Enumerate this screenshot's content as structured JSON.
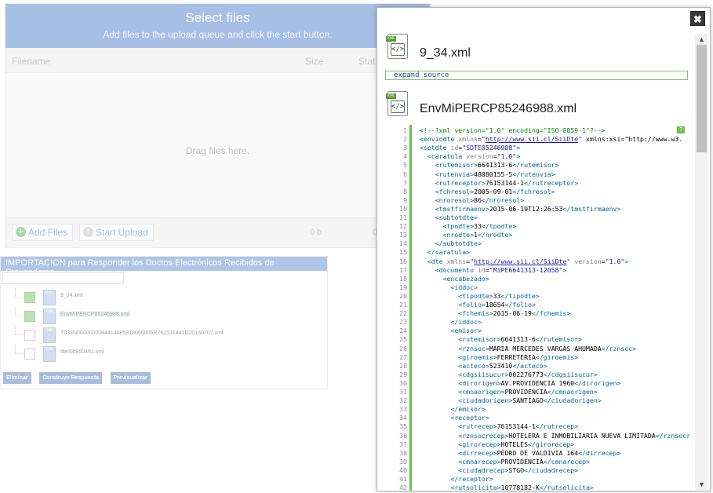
{
  "uploader": {
    "title": "Select files",
    "subtitle": "Add files to the upload queue and click the start button.",
    "col_filename": "Filename",
    "col_size": "Size",
    "col_status": "Stat",
    "drop_text": "Drag files here.",
    "add_files": "Add Files",
    "start_upload": "Start Upload",
    "total_size": "0 b",
    "total_status": "0"
  },
  "import_panel": {
    "title": "IMPORTACION para Responder los Doctos Electrónicos Recibidos de Proveedores",
    "files": [
      {
        "name": "9_34.xml",
        "checked": true
      },
      {
        "name": "EnvMiPERCP85246988.xml",
        "checked": true
      },
      {
        "name": "T033N0000000084414485918060006R761531441D20150707.xml",
        "checked": false
      },
      {
        "name": "dte33f800461.xml",
        "checked": false
      }
    ],
    "buttons": [
      "Eliminar",
      "Construye Respuesta",
      "Previsualizar"
    ]
  },
  "modal": {
    "close_label": "✖",
    "file1": "9_34.xml",
    "expand": "expand source",
    "file2": "EnvMiPERCP85246988.xml",
    "xml_badge": "XML",
    "help_badge": "?",
    "code_lines": [
      "<!--?xml version=\"1.0\" encoding=\"ISO-8859-1\"?-->",
      "<enviodte xmlns=\"http://www.sii.cl/SiiDte\" xmlns:xsi=\"http://www.w3.",
      "<setdte id=\"SDTE85246988\">",
      "  <caratula version=\"1.0\">",
      "    <rutemisor>6641313-6</rutemisor>",
      "    <rutenvia>48080155-5</rutenvia>",
      "    <rutreceptor>76153144-1</rutreceptor>",
      "    <fchresol>2005-09-01</fchresol>",
      "    <nroresol>86</nroresol>",
      "    <tmstfirmaenv>2015-06-19T12:26:53</tmstfirmaenv>",
      "    <subtotdte>",
      "      <tpodte>33</tpodte>",
      "      <nrodte>1</nrodte>",
      "    </subtotdte>",
      "  </caratula>",
      "  <dte xmlns=\"http://www.sii.cl/SiiDte\" version=\"1.0\">",
      "    <documento id=\"MiPE6641313-12058\">",
      "      <encabezado>",
      "        <iddoc>",
      "          <tipodte>33</tipodte>",
      "          <folio>18654</folio>",
      "          <fchemis>2015-06-19</fchemis>",
      "        </iddoc>",
      "        <emisor>",
      "          <rutemisor>6641313-6</rutemisor>",
      "          <rznsoc>MARIA MERCEDES VARGAS AHUMADA</rznsoc>",
      "          <giroemis>FERRETERIA</giroemis>",
      "          <acteco>523410</acteco>",
      "          <cdgsiisucur>002276773</cdgsiisucur>",
      "          <dirorigen>AV.PROVIDENCIA 1960</dirorigen>",
      "          <cmnaorigen>PROVIDENCIA</cmnaorigen>",
      "          <ciudadorigen>SANTIAGO</ciudadorigen>",
      "        </emisor>",
      "        <receptor>",
      "          <rutrecep>76153144-1</rutrecep>",
      "          <rznsocrecep>HOTELERA E INMOBILIARIA NUEVA LIMITADA</rznsocr",
      "          <girorecep>HOTELES</girorecep>",
      "          <dirrecep>PEDRO DE VALDIVIA 164</dirrecep>",
      "          <cmnarecep>PROVIDENCIA</cmnarecep>",
      "          <ciudadrecep>STGO</ciudadrecep>",
      "        </receptor>",
      "        <rutsolicita>10778182-K</rutsolicita>"
    ]
  }
}
